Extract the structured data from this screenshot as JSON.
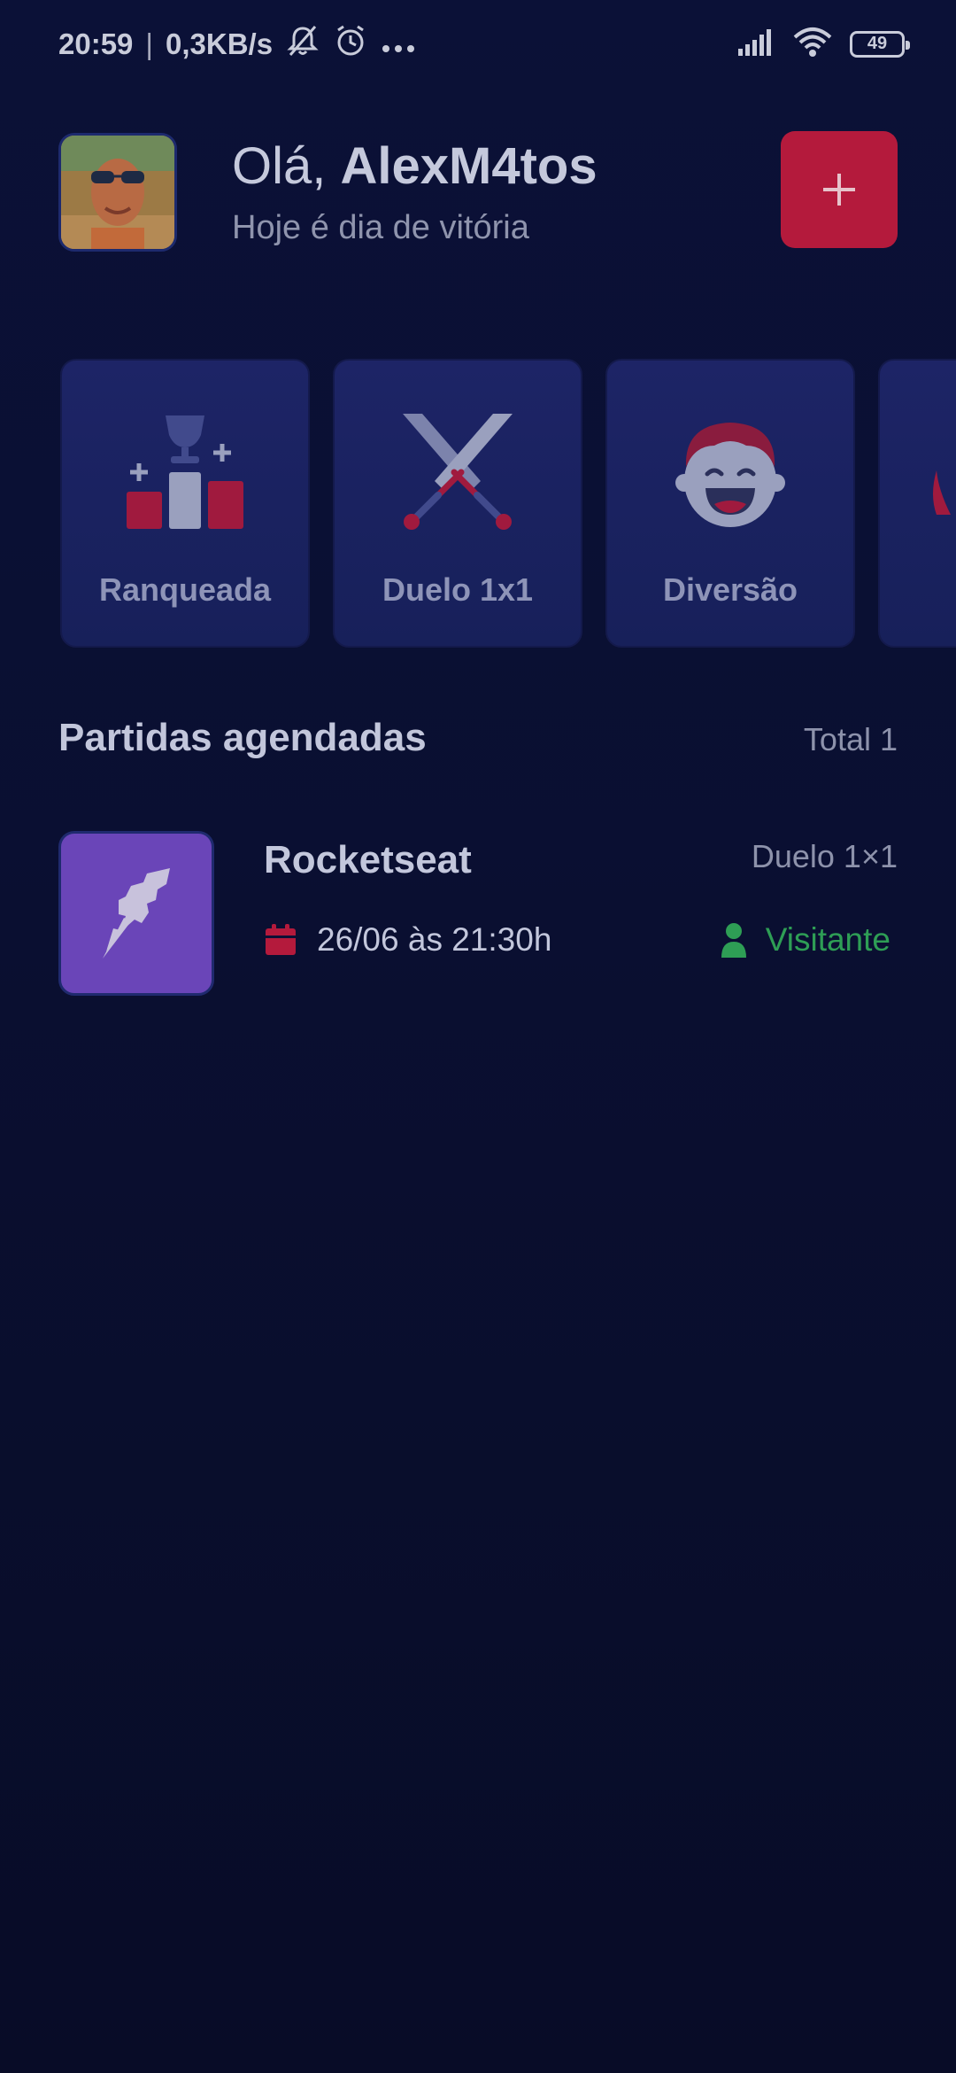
{
  "status_bar": {
    "time": "20:59",
    "separator": "|",
    "network_speed": "0,3KB/s",
    "battery_level": "49",
    "icons": [
      "mute-bell-icon",
      "alarm-icon",
      "more-dots-icon",
      "signal-icon",
      "wifi-icon",
      "battery-icon"
    ]
  },
  "header": {
    "greeting_prefix": "Olá, ",
    "user_name": "AlexM4tos",
    "subtitle": "Hoje é dia de vitória",
    "add_button_label": "+"
  },
  "categories": [
    {
      "label": "Ranqueada",
      "icon": "trophy-podium-icon"
    },
    {
      "label": "Duelo 1x1",
      "icon": "crossed-swords-icon"
    },
    {
      "label": "Diversão",
      "icon": "laughing-face-icon"
    },
    {
      "label": "",
      "icon": "partial-card-icon"
    }
  ],
  "section": {
    "title": "Partidas agendadas",
    "total": "Total 1"
  },
  "matches": [
    {
      "name": "Rocketseat",
      "category": "Duelo 1×1",
      "date": "26/06 às 21:30h",
      "role": "Visitante",
      "logo": "rocketseat-logo"
    }
  ],
  "colors": {
    "background": "#0b1036",
    "card": "#1d2466",
    "accent_red": "#b41a3c",
    "logo_purple": "#6a45b8",
    "visitor_green": "#2e9e55"
  }
}
